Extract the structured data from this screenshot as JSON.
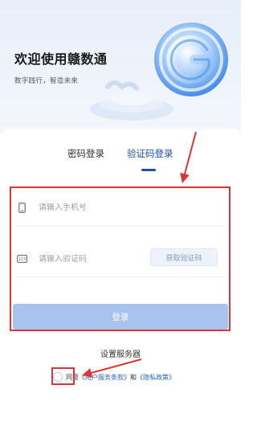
{
  "hero": {
    "title": "欢迎使用赣数通",
    "subtitle": "数字践行，智造未来"
  },
  "tabs": [
    {
      "label": "密码登录",
      "active": false
    },
    {
      "label": "验证码登录",
      "active": true
    }
  ],
  "form": {
    "phone_placeholder": "请输入手机号",
    "code_placeholder": "请输入验证码",
    "get_code_label": "获取验证码",
    "login_label": "登录"
  },
  "footer": {
    "server_label": "设置服务器",
    "agree_prefix": "同意",
    "user_agreement": "《用户服务条款》",
    "and": "和",
    "privacy_policy": "《隐私政策》"
  },
  "colors": {
    "accent": "#1f4fa8",
    "login_button": "#a8c3ee",
    "highlight": "#e03434",
    "link": "#2b63c7"
  },
  "icons": [
    "phone-icon",
    "code-icon",
    "app-logo-icon",
    "annotation-arrow"
  ]
}
